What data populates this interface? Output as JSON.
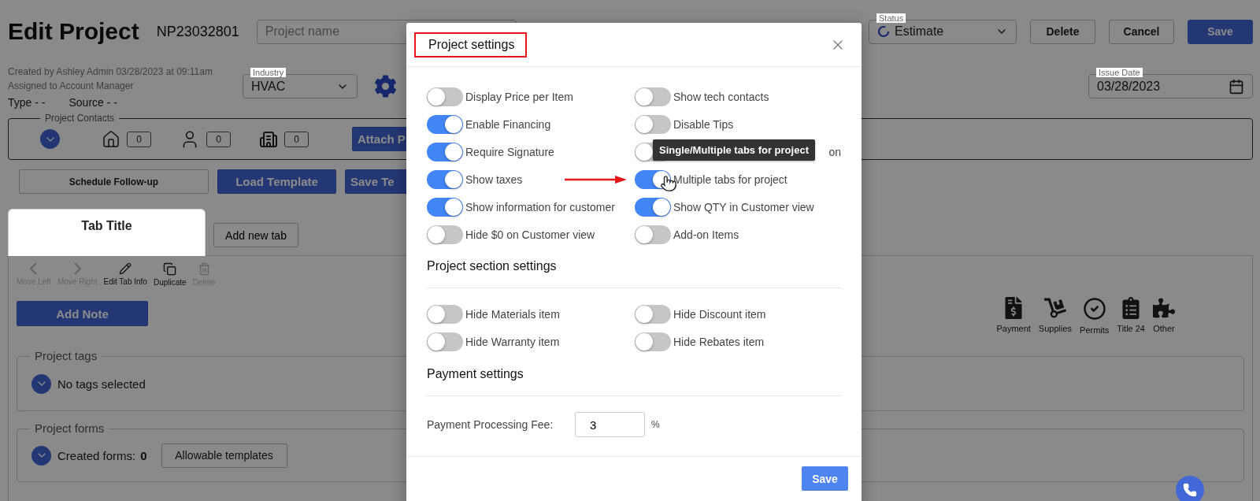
{
  "page": {
    "title": "Edit Project",
    "project_number": "NP23032801",
    "project_name": {
      "placeholder": "Project name"
    },
    "status": {
      "label": "Status",
      "value": "Estimate"
    },
    "buttons": [
      {
        "label": "Delete",
        "kind": "outline"
      },
      {
        "label": "Cancel",
        "kind": "outline"
      },
      {
        "label": "Save",
        "kind": "primary"
      }
    ],
    "created_by": "Created by Ashley Admin 03/28/2023 at 09:11am",
    "assigned_to": "Assigned to Account Manager",
    "type": "Type - -",
    "source": "Source - -",
    "industry": {
      "label": "Industry",
      "value": "HVAC"
    },
    "issue_date": {
      "label": "Issue Date",
      "value": "03/28/2023"
    },
    "contacts": {
      "legend": "Project Contacts",
      "items": [
        {
          "kind": "home",
          "count": "0"
        },
        {
          "kind": "person",
          "count": "0"
        },
        {
          "kind": "company",
          "count": "0"
        }
      ],
      "attach_button": "Attach P"
    },
    "actions": [
      {
        "label": "Schedule Follow-up",
        "kind": "outline"
      },
      {
        "label": "Load Template",
        "kind": "primary"
      },
      {
        "label": "Save Te",
        "kind": "primary"
      }
    ],
    "tabs": [
      {
        "label": "Tab Title",
        "selected": true
      }
    ],
    "add_tab": "Add new tab",
    "tab_tools": [
      {
        "kind": "left",
        "label": "Move Left",
        "disabled": true
      },
      {
        "kind": "right",
        "label": "Move Right",
        "disabled": true
      },
      {
        "kind": "edit",
        "label": "Edit Tab Info",
        "disabled": false
      },
      {
        "kind": "duplicate",
        "label": "Duplicate",
        "disabled": false
      },
      {
        "kind": "delete",
        "label": "Delete",
        "disabled": true
      }
    ],
    "add_note": "Add Note",
    "tags": {
      "legend": "Project tags",
      "text": "No tags selected"
    },
    "forms": {
      "legend": "Project forms",
      "label": "Created forms:",
      "count": "0",
      "button": "Allowable templates"
    },
    "categories": [
      {
        "kind": "payment",
        "label": "Payment"
      },
      {
        "kind": "supplies",
        "label": "Supplies"
      },
      {
        "kind": "permits",
        "label": "Permits"
      },
      {
        "kind": "title24",
        "label": "Title 24"
      },
      {
        "kind": "other",
        "label": "Other"
      }
    ]
  },
  "dialog": {
    "title": "Project settings",
    "title_highlighted": true,
    "display_settings": [
      {
        "label": "Display Price per Item",
        "on": false
      },
      {
        "label": "Show tech contacts",
        "on": false
      },
      {
        "label": "Enable Financing",
        "on": true
      },
      {
        "label": "Disable Tips",
        "on": false
      },
      {
        "label": "Require Signature",
        "on": true
      },
      {
        "label": "on",
        "on": false,
        "covered": true
      },
      {
        "label": "Show taxes",
        "on": true
      },
      {
        "label": "Multiple tabs for project",
        "on": true,
        "highlighted": true,
        "tooltip": "Single/Multiple tabs for project"
      },
      {
        "label": "Show information for customer",
        "on": true
      },
      {
        "label": "Show QTY in Customer view",
        "on": true
      },
      {
        "label": "Hide $0 on Customer view",
        "on": false
      },
      {
        "label": "Add-on Items",
        "on": false
      }
    ],
    "section_settings": {
      "heading": "Project section settings",
      "items": [
        {
          "label": "Hide Materials item",
          "on": false
        },
        {
          "label": "Hide Discount item",
          "on": false
        },
        {
          "label": "Hide Warranty item",
          "on": false
        },
        {
          "label": "Hide Rebates item",
          "on": false
        }
      ]
    },
    "payment_settings": {
      "heading": "Payment settings",
      "fee_label": "Payment Processing Fee:",
      "fee_value": "3",
      "unit": "%"
    },
    "save": "Save"
  }
}
